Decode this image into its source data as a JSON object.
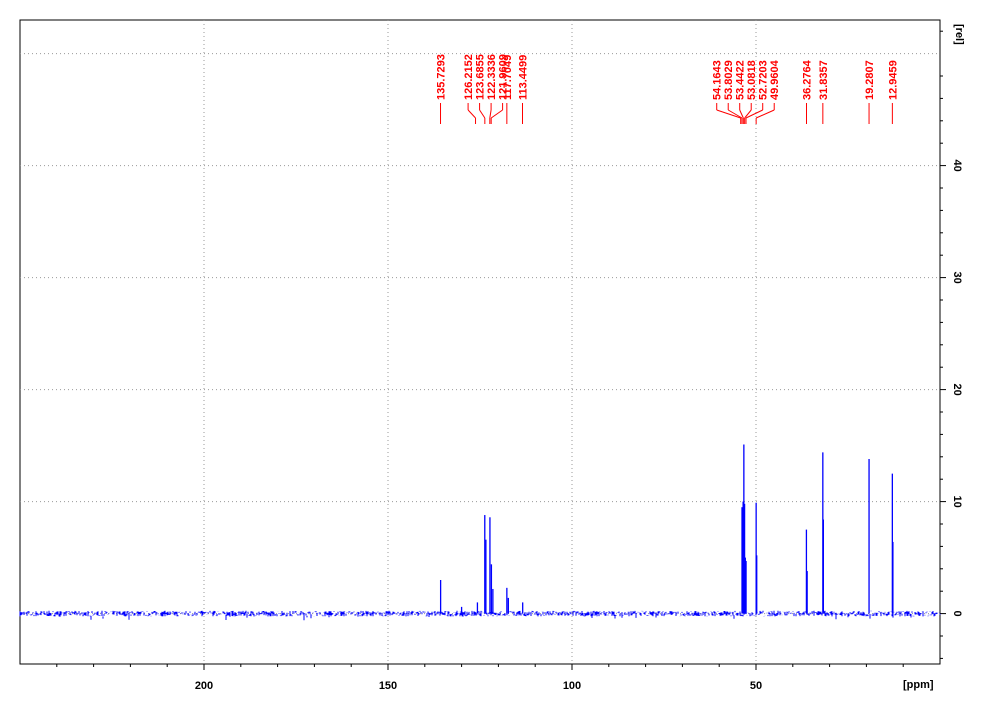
{
  "chart_data": {
    "type": "line",
    "title": "",
    "xlabel": "[ppm]",
    "ylabel": "[rel]",
    "xlim": [
      250,
      0
    ],
    "ylim": [
      -4.5,
      53
    ],
    "x_ticks": [
      200,
      150,
      100,
      50
    ],
    "y_ticks": [
      0,
      10,
      20,
      30,
      40
    ],
    "grid": true,
    "colors": {
      "spectrum": "#0000ff",
      "peak_labels": "#ff0000",
      "grid": "#999999",
      "axis": "#000000"
    },
    "peak_labels": [
      "135.7293",
      "126.2152",
      "123.6855",
      "122.3336",
      "121.9609",
      "117.7049",
      "113.4499",
      "54.1643",
      "53.8029",
      "53.4422",
      "53.0818",
      "52.7203",
      "49.9604",
      "36.2764",
      "31.8357",
      "19.2807",
      "12.9459"
    ],
    "peak_positions": [
      135.7293,
      126.2152,
      123.6855,
      122.3336,
      121.9609,
      117.7049,
      113.4499,
      54.1643,
      53.8029,
      53.4422,
      53.0818,
      52.7203,
      49.9604,
      36.2764,
      31.8357,
      19.2807,
      12.9459
    ],
    "peaks": [
      {
        "x": 135.7,
        "y": 3.0
      },
      {
        "x": 130.0,
        "y": 0.6
      },
      {
        "x": 125.7,
        "y": 1.0
      },
      {
        "x": 123.7,
        "y": 8.8
      },
      {
        "x": 123.4,
        "y": 6.6
      },
      {
        "x": 122.3,
        "y": 8.6
      },
      {
        "x": 121.9,
        "y": 4.4
      },
      {
        "x": 121.5,
        "y": 2.2
      },
      {
        "x": 117.7,
        "y": 2.3
      },
      {
        "x": 117.3,
        "y": 1.4
      },
      {
        "x": 113.4,
        "y": 1.0
      },
      {
        "x": 53.8,
        "y": 9.5
      },
      {
        "x": 53.5,
        "y": 10.0
      },
      {
        "x": 53.3,
        "y": 15.1
      },
      {
        "x": 53.1,
        "y": 9.8
      },
      {
        "x": 52.9,
        "y": 5.0
      },
      {
        "x": 52.7,
        "y": 4.7
      },
      {
        "x": 49.96,
        "y": 9.9
      },
      {
        "x": 49.8,
        "y": 5.2
      },
      {
        "x": 36.3,
        "y": 7.5
      },
      {
        "x": 36.1,
        "y": 3.8
      },
      {
        "x": 31.84,
        "y": 14.4
      },
      {
        "x": 31.7,
        "y": 8.4
      },
      {
        "x": 19.28,
        "y": 13.8
      },
      {
        "x": 12.95,
        "y": 12.5
      },
      {
        "x": 12.8,
        "y": 6.4
      }
    ]
  }
}
